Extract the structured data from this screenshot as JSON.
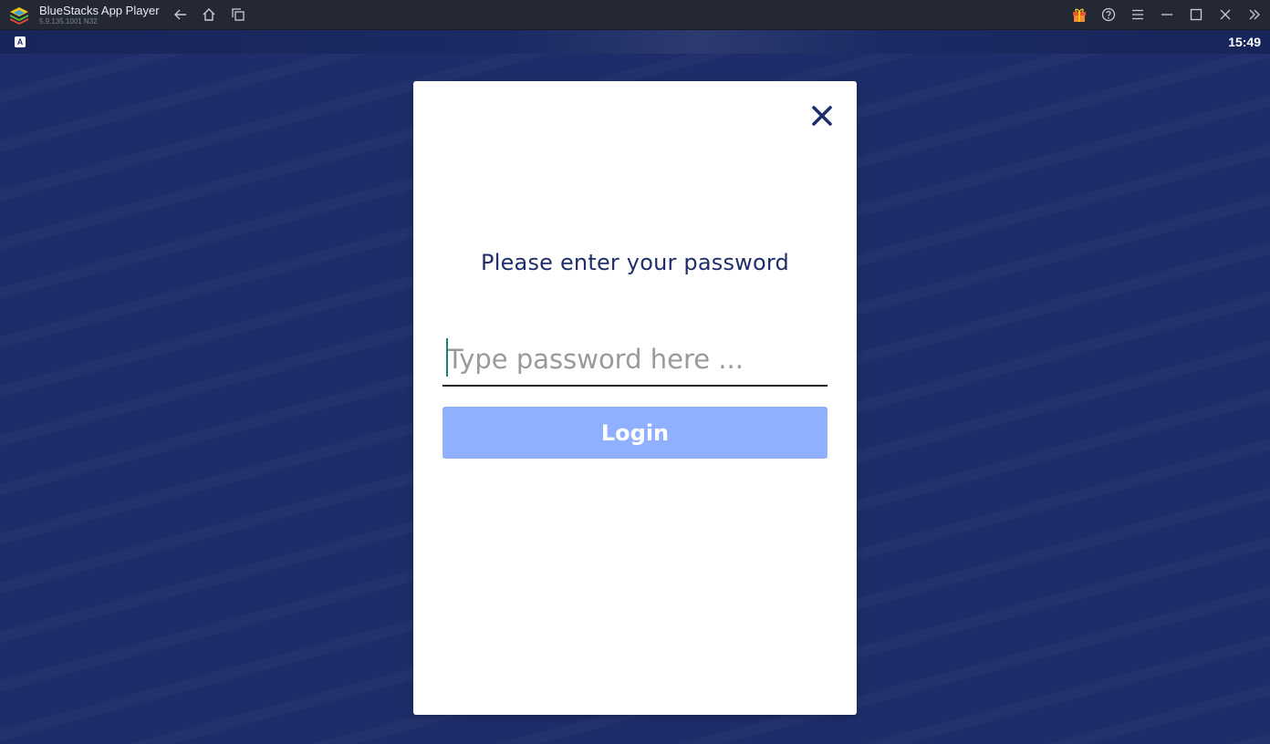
{
  "window": {
    "app_title": "BlueStacks App Player",
    "app_version": "5.9.135.1001 N32"
  },
  "titlebar": {
    "icons": [
      "back-icon",
      "home-icon",
      "multitask-icon",
      "gift-icon",
      "help-icon",
      "menu-icon",
      "minimize-icon",
      "maximize-icon",
      "close-icon",
      "collapse-sidebar-icon"
    ]
  },
  "statusbar": {
    "notification_icon_text": "A",
    "time": "15:49"
  },
  "dialog": {
    "heading": "Please enter your password",
    "password_placeholder": "Type password here ...",
    "password_value": "",
    "login_label": "Login",
    "close_icon": "close-icon"
  },
  "colors": {
    "background": "#1f2e6b",
    "heading_text": "#1f2e6b",
    "login_button": "#8fb0ff",
    "titlebar": "#232834",
    "gift_icon": "#e4572e"
  }
}
